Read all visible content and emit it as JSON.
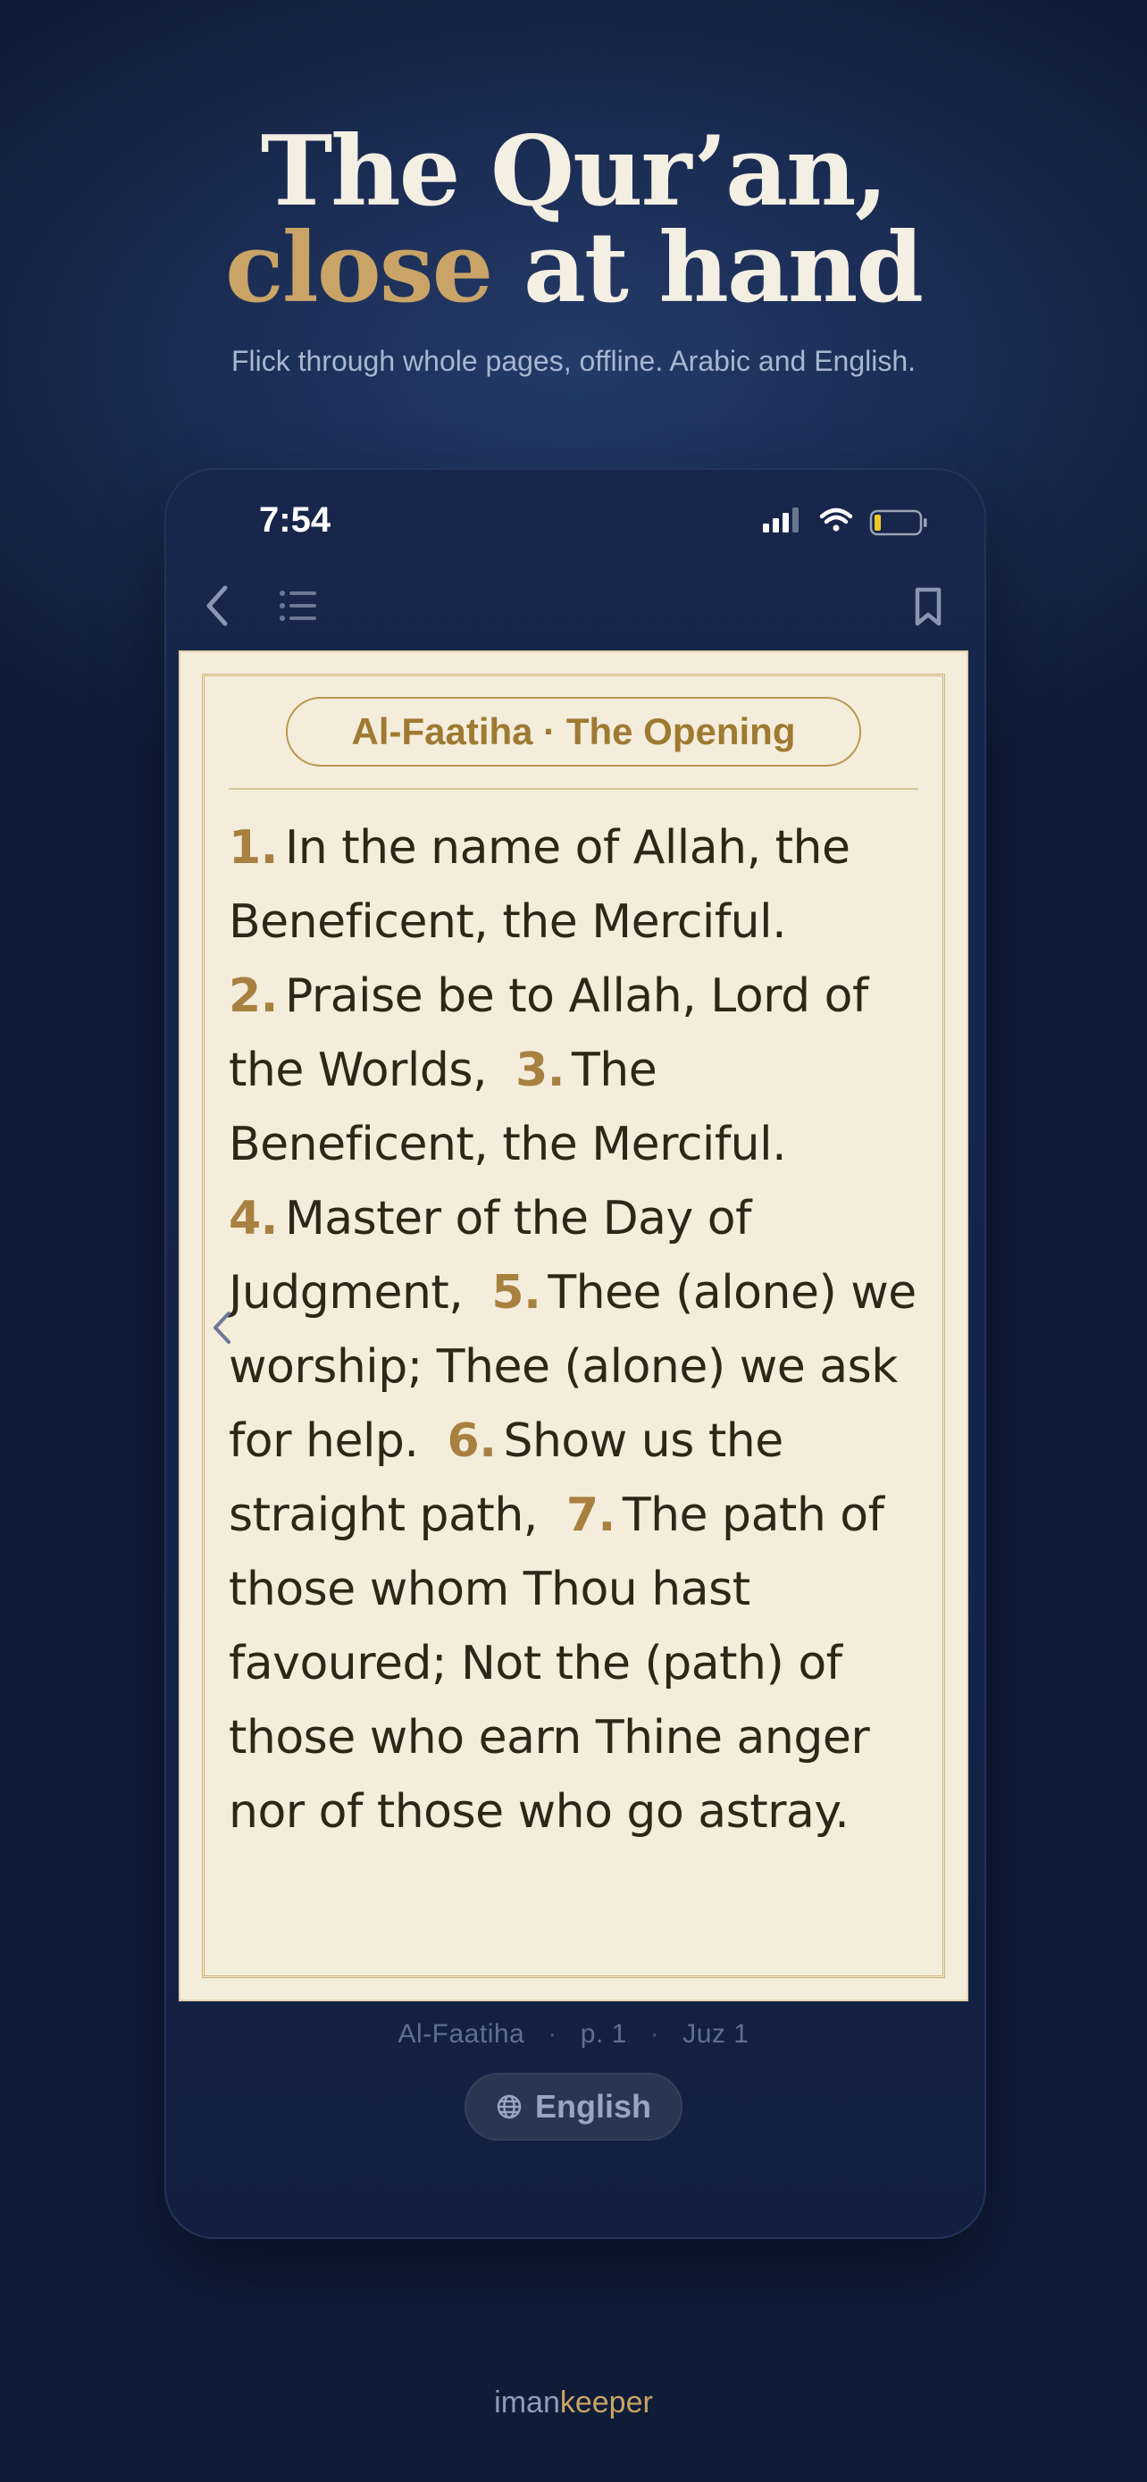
{
  "hero": {
    "line1": "The Qur’an,",
    "line2_accent": "close",
    "line2_rest": " at hand",
    "subtitle": "Flick through whole pages, offline. Arabic and English."
  },
  "status_bar": {
    "time": "7:54",
    "icons": [
      "cellular-signal-icon",
      "wifi-icon",
      "battery-icon"
    ]
  },
  "toolbar": {
    "icons": [
      "back-chevron-icon",
      "list-icon",
      "bookmark-icon"
    ]
  },
  "reader": {
    "surah_title": "Al-Faatiha · The Opening",
    "verses": [
      {
        "num": "1.",
        "text": "In the name of Allah, the Beneficent, the Merciful."
      },
      {
        "num": "2.",
        "text": "Praise be to Allah, Lord of the Worlds,"
      },
      {
        "num": "3.",
        "text": "The Beneficent, the Merciful."
      },
      {
        "num": "4.",
        "text": "Master of the Day of Judgment,"
      },
      {
        "num": "5.",
        "text": "Thee (alone) we worship; Thee (alone) we ask for help."
      },
      {
        "num": "6.",
        "text": "Show us the straight path,"
      },
      {
        "num": "7.",
        "text": "The path of those whom Thou hast favoured; Not the (path) of those who earn Thine anger nor of those who go astray."
      }
    ]
  },
  "page_info": {
    "surah": "Al-Faatiha",
    "page": "p. 1",
    "juz": "Juz 1",
    "separator": "·"
  },
  "language_button": {
    "label": "English",
    "icon": "globe-icon"
  },
  "brand": {
    "part1": "iman",
    "part2": "keeper"
  },
  "colors": {
    "background": "#1b2d54",
    "accent_gold": "#c9a466",
    "page_paper": "#f5eddb",
    "verse_number": "#a88040",
    "verse_text": "#2e2616"
  }
}
